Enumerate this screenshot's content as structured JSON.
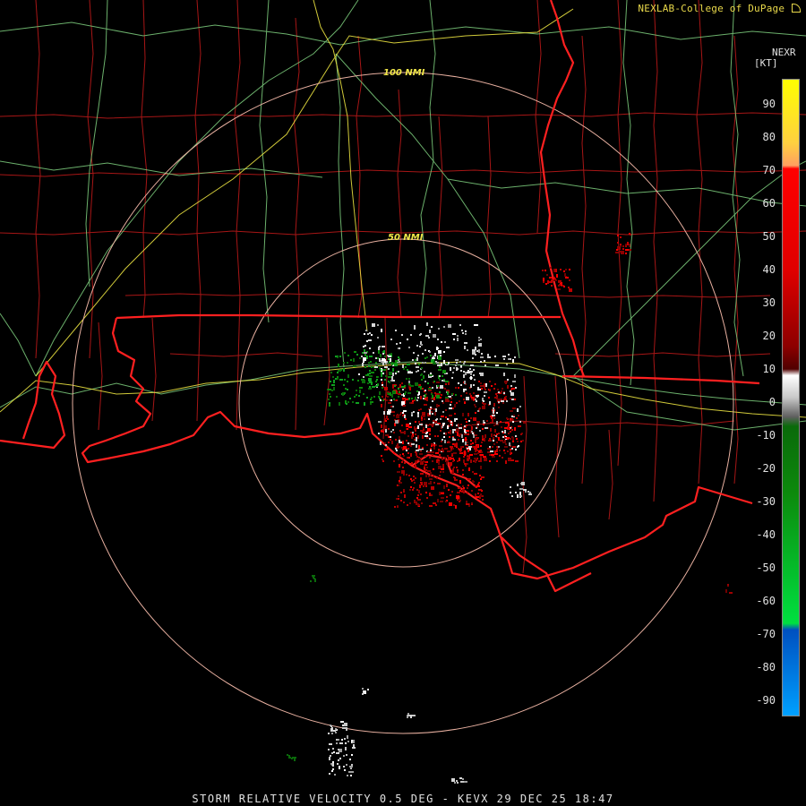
{
  "header": {
    "credit": "NEXLAB-College of DuPage",
    "credit_icon": "gauge-icon",
    "product": "NEXR",
    "units": "[KT]"
  },
  "range_rings": [
    {
      "label": "100 NMI",
      "range_nmi": 100
    },
    {
      "label": "50 NMI",
      "range_nmi": 50
    }
  ],
  "scale": {
    "ticks": [
      "90",
      "80",
      "70",
      "60",
      "50",
      "40",
      "30",
      "20",
      "10",
      "0",
      "-10",
      "-20",
      "-30",
      "-40",
      "-50",
      "-60",
      "-70",
      "-80",
      "-90"
    ],
    "colors": {
      "outbound_high": "#ffff00",
      "outbound": "#ff0000",
      "outbound_dark": "#8c0000",
      "near_zero": "#c8c8c8",
      "inbound_dark": "#0a6a0a",
      "inbound": "#00e040",
      "inbound_high": "#00a0ff"
    }
  },
  "caption": "STORM RELATIVE VELOCITY 0.5 DEG - KEVX 29 DEC 25 18:47"
}
